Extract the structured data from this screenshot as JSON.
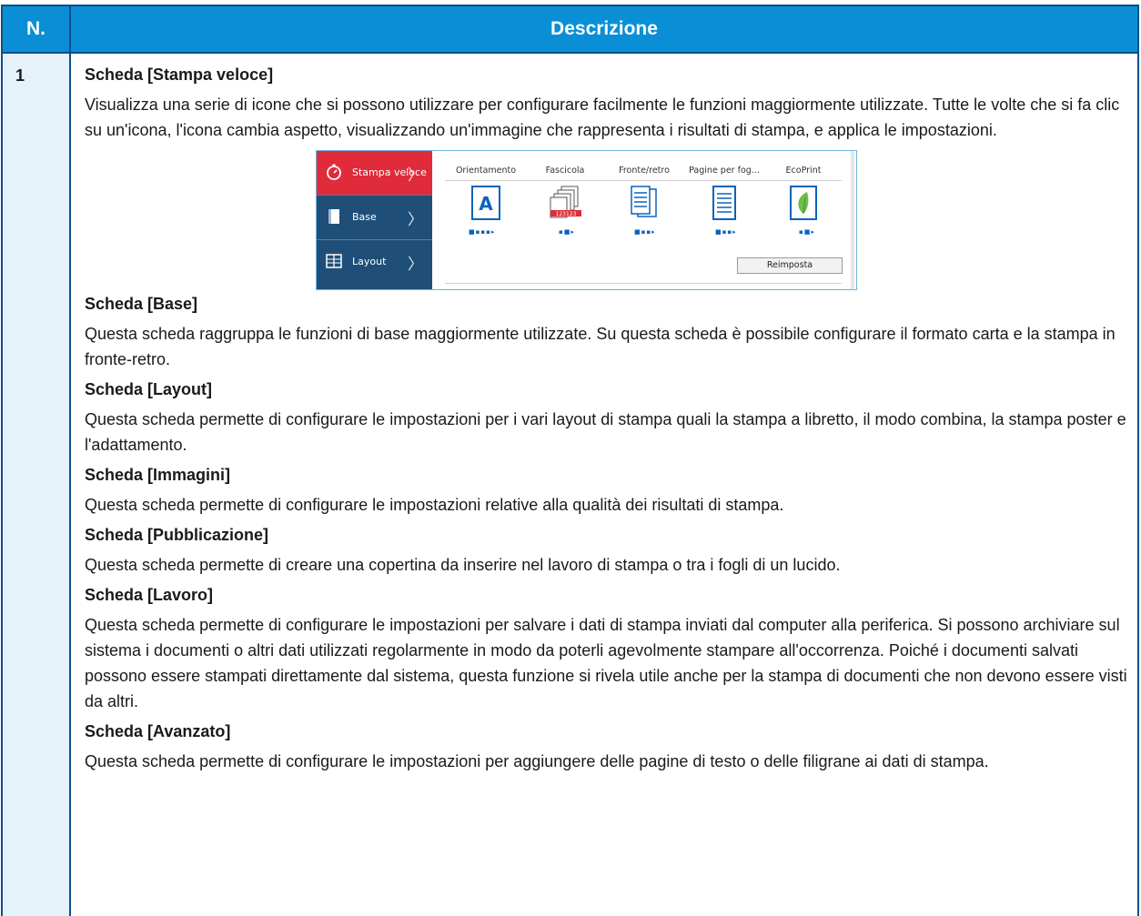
{
  "table": {
    "header_n": "N.",
    "header_desc": "Descrizione",
    "row_number": "1"
  },
  "sections": [
    {
      "title": "Scheda [Stampa veloce]",
      "body": "Visualizza una serie di icone che si possono utilizzare per configurare facilmente le funzioni maggiormente utilizzate. Tutte le volte che si fa clic su un'icona, l'icona cambia aspetto, visualizzando un'immagine che rappresenta i risultati di stampa, e applica le impostazioni."
    },
    {
      "title": "Scheda [Base]",
      "body": "Questa scheda raggruppa le funzioni di base maggiormente utilizzate. Su questa scheda è possibile configurare il formato carta e la stampa in fronte-retro."
    },
    {
      "title": "Scheda [Layout]",
      "body": "Questa scheda permette di configurare le impostazioni per i vari layout di stampa quali la stampa a libretto, il modo combina, la stampa poster e l'adattamento."
    },
    {
      "title": "Scheda [Immagini]",
      "body": "Questa scheda permette di configurare le impostazioni relative alla qualità dei risultati di stampa."
    },
    {
      "title": "Scheda [Pubblicazione]",
      "body": "Questa scheda permette di creare una copertina da inserire nel lavoro di stampa o tra i fogli di un lucido."
    },
    {
      "title": "Scheda [Lavoro]",
      "body": "Questa scheda permette di configurare le impostazioni per salvare i dati di stampa inviati dal computer alla periferica. Si possono archiviare sul sistema i documenti o altri dati utilizzati regolarmente in modo da poterli agevolmente stampare all'occorrenza. Poiché i documenti salvati possono essere stampati direttamente dal sistema, questa funzione si rivela utile anche per la stampa di documenti che non devono essere visti da altri."
    },
    {
      "title": "Scheda [Avanzato]",
      "body": "Questa scheda permette di configurare le impostazioni per aggiungere delle pagine di testo o delle filigrane ai dati di stampa."
    }
  ],
  "mini_ui": {
    "sidebar": [
      "Stampa veloce",
      "Base",
      "Layout"
    ],
    "options": [
      "Orientamento",
      "Fascicola",
      "Fronte/retro",
      "Pagine per fog...",
      "EcoPrint"
    ],
    "reset_label": "Reimposta",
    "icon_letter": "A",
    "collate_numbers": "123123",
    "colors": {
      "sidebar_bg": "#1f4f78",
      "active_tab": "#e02b3a",
      "accent_blue": "#0a63b8",
      "leaf_green": "#6cc04a"
    }
  },
  "colors": {
    "header_bg": "#0a8fd6",
    "number_col_bg": "#e6f2fa",
    "border": "#0a4f8a"
  }
}
